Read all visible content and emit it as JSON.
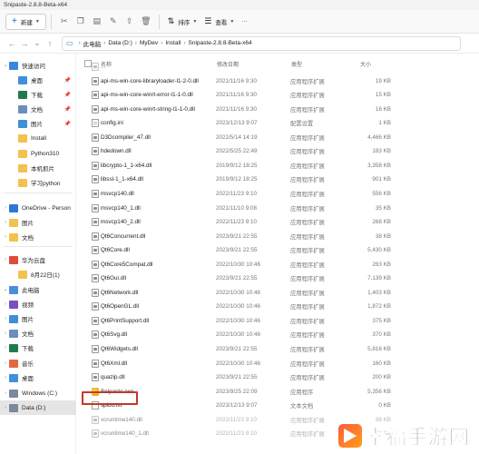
{
  "window": {
    "title": "Snipaste-2.8.8-Beta-x64"
  },
  "toolbar": {
    "new_label": "新建",
    "sort_label": "排序",
    "view_label": "查看",
    "more_label": "···"
  },
  "address": {
    "crumbs": [
      "此电脑",
      "Data (D:)",
      "MyDev",
      "Install",
      "Snipaste-2.8.8-Beta-x64"
    ]
  },
  "sidebar": {
    "items": [
      {
        "label": "快速访问",
        "icon": "star-icon",
        "color": "#3b86d9",
        "expandable": true
      },
      {
        "label": "桌面",
        "icon": "desktop-icon",
        "color": "#3f8fdc",
        "pinned": true
      },
      {
        "label": "下载",
        "icon": "download-icon",
        "color": "#1f7a4d",
        "pinned": true
      },
      {
        "label": "文档",
        "icon": "document-icon",
        "color": "#6c8ebf",
        "pinned": true
      },
      {
        "label": "图片",
        "icon": "picture-icon",
        "color": "#3d8fd6",
        "pinned": true
      },
      {
        "label": "Install",
        "icon": "folder-icon",
        "color": "#f2c14e"
      },
      {
        "label": "Python310",
        "icon": "folder-icon",
        "color": "#f2c14e"
      },
      {
        "label": "本机抓片",
        "icon": "folder-icon",
        "color": "#f2c14e"
      },
      {
        "label": "学习python",
        "icon": "folder-icon",
        "color": "#f2c14e"
      },
      {
        "label": "OneDrive - Person",
        "icon": "cloud-icon",
        "color": "#2b78d4",
        "expandable": true
      },
      {
        "label": "图片",
        "icon": "folder-icon",
        "color": "#f2c14e",
        "expandable": true
      },
      {
        "label": "文档",
        "icon": "folder-icon",
        "color": "#f2c14e",
        "expandable": true
      },
      {
        "label": "华为云盘",
        "icon": "cloud-icon",
        "color": "#e04b3a",
        "expandable": true
      },
      {
        "label": "8月22日(1)",
        "icon": "folder-icon",
        "color": "#f2c14e"
      },
      {
        "label": "此电脑",
        "icon": "computer-icon",
        "color": "#4a90d9",
        "expandable": true
      },
      {
        "label": "视频",
        "icon": "video-icon",
        "color": "#7a4fbf",
        "expandable": true
      },
      {
        "label": "图片",
        "icon": "picture-icon",
        "color": "#3d8fd6",
        "expandable": true
      },
      {
        "label": "文档",
        "icon": "document-icon",
        "color": "#6c8ebf",
        "expandable": true
      },
      {
        "label": "下载",
        "icon": "download-icon",
        "color": "#1f7a4d",
        "expandable": true
      },
      {
        "label": "音乐",
        "icon": "music-icon",
        "color": "#e3683e",
        "expandable": true
      },
      {
        "label": "桌面",
        "icon": "desktop-icon",
        "color": "#3f8fdc",
        "expandable": true
      },
      {
        "label": "Windows (C:)",
        "icon": "drive-icon",
        "color": "#7a8a99",
        "expandable": true
      },
      {
        "label": "Data (D:)",
        "icon": "drive-icon",
        "color": "#7a8a99",
        "expandable": true,
        "selected": true
      }
    ]
  },
  "columns": {
    "name": "名称",
    "date": "修改日期",
    "type": "类型",
    "size": "大小"
  },
  "files": [
    {
      "name": "...",
      "date": "",
      "type": "",
      "size": "",
      "kind": "dll",
      "faded": true
    },
    {
      "name": "api-ms-win-core-libraryloader-l1-2-0.dll",
      "date": "2021/11/16 9:30",
      "type": "应用程序扩展",
      "size": "19 KB",
      "kind": "dll"
    },
    {
      "name": "api-ms-win-core-winrt-error-l1-1-0.dll",
      "date": "2021/11/16 9:30",
      "type": "应用程序扩展",
      "size": "15 KB",
      "kind": "dll"
    },
    {
      "name": "api-ms-win-core-winrt-string-l1-1-0.dll",
      "date": "2021/11/16 9:30",
      "type": "应用程序扩展",
      "size": "16 KB",
      "kind": "dll"
    },
    {
      "name": "config.ini",
      "date": "2023/12/13 9:07",
      "type": "配置设置",
      "size": "1 KB",
      "kind": "ini"
    },
    {
      "name": "D3Dcompiler_47.dll",
      "date": "2022/5/14 14:19",
      "type": "应用程序扩展",
      "size": "4,466 KB",
      "kind": "dll"
    },
    {
      "name": "hdedown.dll",
      "date": "2022/5/25 22:49",
      "type": "应用程序扩展",
      "size": "183 KB",
      "kind": "dll"
    },
    {
      "name": "libcrypto-1_1-x64.dll",
      "date": "2019/9/12 18:25",
      "type": "应用程序扩展",
      "size": "3,358 KB",
      "kind": "dll"
    },
    {
      "name": "libssl-1_1-x64.dll",
      "date": "2019/9/12 18:25",
      "type": "应用程序扩展",
      "size": "901 KB",
      "kind": "dll"
    },
    {
      "name": "msvcp140.dll",
      "date": "2022/11/23 9:10",
      "type": "应用程序扩展",
      "size": "556 KB",
      "kind": "dll"
    },
    {
      "name": "msvcp140_1.dll",
      "date": "2021/11/10 9:08",
      "type": "应用程序扩展",
      "size": "35 KB",
      "kind": "dll"
    },
    {
      "name": "msvcp140_2.dll",
      "date": "2022/11/23 9:10",
      "type": "应用程序扩展",
      "size": "268 KB",
      "kind": "dll"
    },
    {
      "name": "Qt6Concurrent.dll",
      "date": "2023/9/21 22:55",
      "type": "应用程序扩展",
      "size": "38 KB",
      "kind": "dll"
    },
    {
      "name": "Qt6Core.dll",
      "date": "2023/9/21 22:55",
      "type": "应用程序扩展",
      "size": "5,430 KB",
      "kind": "dll"
    },
    {
      "name": "Qt6Core5Compat.dll",
      "date": "2022/10/30 10:46",
      "type": "应用程序扩展",
      "size": "263 KB",
      "kind": "dll"
    },
    {
      "name": "Qt6Gui.dll",
      "date": "2023/9/21 22:55",
      "type": "应用程序扩展",
      "size": "7,139 KB",
      "kind": "dll"
    },
    {
      "name": "Qt6Network.dll",
      "date": "2022/10/30 10:46",
      "type": "应用程序扩展",
      "size": "1,403 KB",
      "kind": "dll"
    },
    {
      "name": "Qt6OpenGL.dll",
      "date": "2022/10/30 10:46",
      "type": "应用程序扩展",
      "size": "1,872 KB",
      "kind": "dll"
    },
    {
      "name": "Qt6PrintSupport.dll",
      "date": "2022/10/30 10:46",
      "type": "应用程序扩展",
      "size": "375 KB",
      "kind": "dll"
    },
    {
      "name": "Qt6Svg.dll",
      "date": "2022/10/30 10:46",
      "type": "应用程序扩展",
      "size": "370 KB",
      "kind": "dll"
    },
    {
      "name": "Qt6Widgets.dll",
      "date": "2023/9/21 22:55",
      "type": "应用程序扩展",
      "size": "5,816 KB",
      "kind": "dll"
    },
    {
      "name": "Qt6Xml.dll",
      "date": "2022/10/30 10:46",
      "type": "应用程序扩展",
      "size": "160 KB",
      "kind": "dll"
    },
    {
      "name": "quazip.dll",
      "date": "2023/9/21 22:55",
      "type": "应用程序扩展",
      "size": "200 KB",
      "kind": "dll"
    },
    {
      "name": "Snipaste.exe",
      "date": "2023/9/25 22:09",
      "type": "应用程序",
      "size": "5,356 KB",
      "kind": "exe"
    },
    {
      "name": "sploo.txt",
      "date": "2023/12/13 9:07",
      "type": "文本文档",
      "size": "0 KB",
      "kind": "txt"
    },
    {
      "name": "vcruntime140.dll",
      "date": "2022/11/23 9:10",
      "type": "应用程序扩展",
      "size": "98 KB",
      "kind": "dll",
      "faded": true
    },
    {
      "name": "vcruntime140_1.dll",
      "date": "2022/11/23 9:10",
      "type": "应用程序扩展",
      "size": "38 KB",
      "kind": "dll",
      "faded": true
    }
  ],
  "watermark": {
    "text": "幸福手游网"
  },
  "colors": {
    "accent": "#0067c0",
    "highlight": "#c0392b"
  }
}
